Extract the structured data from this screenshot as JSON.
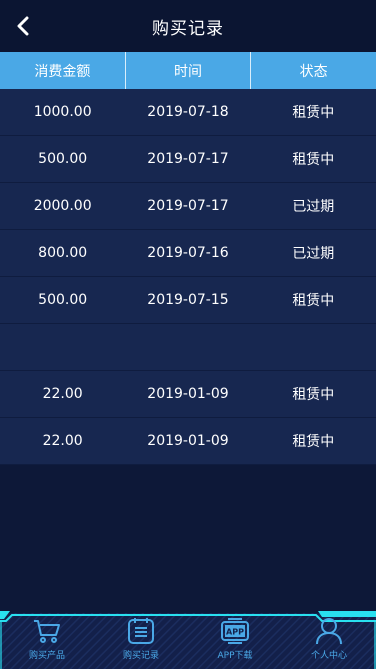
{
  "header": {
    "title": "购买记录"
  },
  "table": {
    "columns": [
      "消费金额",
      "时间",
      "状态"
    ],
    "rows": [
      {
        "amount": "1000.00",
        "date": "2019-07-18",
        "status": "租赁中"
      },
      {
        "amount": "500.00",
        "date": "2019-07-17",
        "status": "租赁中"
      },
      {
        "amount": "2000.00",
        "date": "2019-07-17",
        "status": "已过期"
      },
      {
        "amount": "800.00",
        "date": "2019-07-16",
        "status": "已过期"
      },
      {
        "amount": "500.00",
        "date": "2019-07-15",
        "status": "租赁中"
      },
      {
        "amount": "",
        "date": "",
        "status": ""
      },
      {
        "amount": "22.00",
        "date": "2019-01-09",
        "status": "租赁中"
      },
      {
        "amount": "22.00",
        "date": "2019-01-09",
        "status": "租赁中"
      }
    ]
  },
  "tabbar": {
    "items": [
      {
        "label": "购买产品",
        "icon": "cart-icon"
      },
      {
        "label": "购买记录",
        "icon": "list-icon"
      },
      {
        "label": "APP下载",
        "icon": "app-icon",
        "badge": "APP"
      },
      {
        "label": "个人中心",
        "icon": "person-icon"
      }
    ]
  },
  "colors": {
    "background": "#0d1838",
    "header": "#0b1532",
    "table_header": "#4aa8e6",
    "table_body": "#172750",
    "accent": "#4aa8e6",
    "tabbar_glow": "#29e0f0"
  }
}
